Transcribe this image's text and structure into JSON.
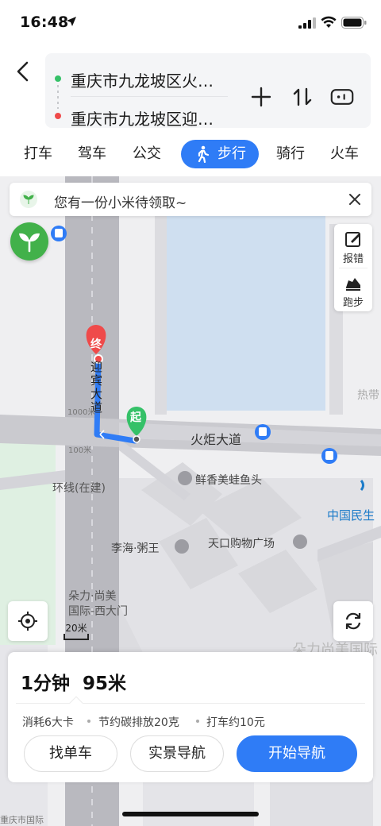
{
  "status_bar": {
    "time": "16:48"
  },
  "route": {
    "start": "重庆市九龙坡区火…",
    "end": "重庆市九龙坡区迎…"
  },
  "tabs": [
    {
      "label": "打车"
    },
    {
      "label": "驾车"
    },
    {
      "label": "公交"
    },
    {
      "label": "步行",
      "active": true
    },
    {
      "label": "骑行"
    },
    {
      "label": "火车"
    }
  ],
  "banner": {
    "text": "您有一份小米待领取~"
  },
  "side_tools": {
    "report": "报错",
    "run": "跑步"
  },
  "map": {
    "pin_end": "终",
    "pin_start": "起",
    "labels": {
      "yingbin_road": "迎宾大道",
      "huoju_road": "火炬大道",
      "ring_road": "环线(在建)",
      "restaurant": "鲜香美蛙鱼头",
      "congee": "李海·粥王",
      "mall": "天口购物广场",
      "bank": "中国民生",
      "duoli": "朵力·尚美\n国际-西大门",
      "duoli_big": "朵力尚美国际",
      "hot": "热带",
      "road_num1": "1000米",
      "road_num2": "100米",
      "bottom_left": "重庆市国际"
    },
    "scale": "20米"
  },
  "summary": {
    "eta": "1分钟",
    "distance": "95米",
    "calories": "消耗6大卡",
    "carbon": "节约碳排放20克",
    "taxi": "打车约10元"
  },
  "actions": {
    "bike": "找单车",
    "ar": "实景导航",
    "start": "开始导航"
  },
  "colors": {
    "accent": "#2f7cf6",
    "start_green": "#35c168",
    "end_red": "#ef4a4a"
  }
}
